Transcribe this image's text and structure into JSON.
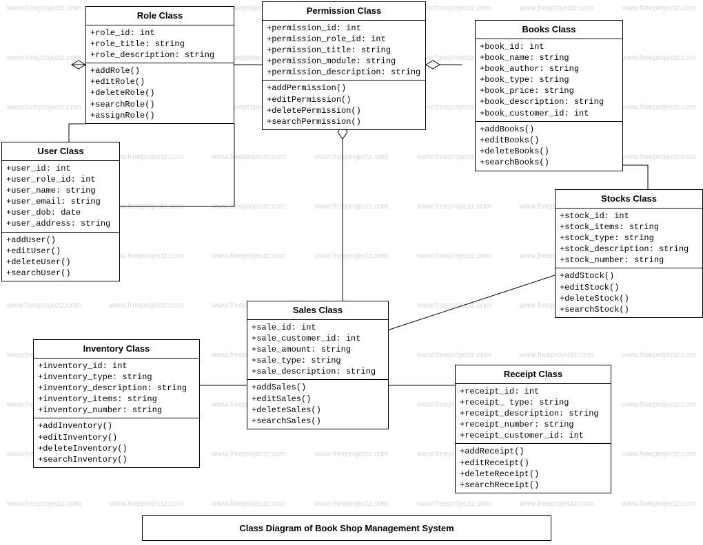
{
  "watermark_text": "www.freeprojectz.com",
  "diagram_title": "Class Diagram of Book Shop Management System",
  "classes": {
    "role": {
      "title": "Role Class",
      "attrs": [
        "+role_id: int",
        "+role_title: string",
        "+role_description: string"
      ],
      "ops": [
        "+addRole()",
        "+editRole()",
        "+deleteRole()",
        "+searchRole()",
        "+assignRole()"
      ]
    },
    "permission": {
      "title": "Permission Class",
      "attrs": [
        "+permission_id: int",
        "+permission_role_id: int",
        "+permission_title: string",
        "+permission_module: string",
        "+permission_description: string"
      ],
      "ops": [
        "+addPermission()",
        "+editPermission()",
        "+deletePermission()",
        "+searchPermission()"
      ]
    },
    "books": {
      "title": "Books Class",
      "attrs": [
        "+book_id: int",
        "+book_name: string",
        "+book_author: string",
        "+book_type: string",
        "+book_price: string",
        "+book_description: string",
        "+book_customer_id: int"
      ],
      "ops": [
        "+addBooks()",
        "+editBooks()",
        "+deleteBooks()",
        "+searchBooks()"
      ]
    },
    "user": {
      "title": "User Class",
      "attrs": [
        "+user_id: int",
        "+user_role_id: int",
        "+user_name: string",
        "+user_email: string",
        "+user_dob: date",
        "+user_address: string"
      ],
      "ops": [
        "+addUser()",
        "+editUser()",
        "+deleteUser()",
        "+searchUser()"
      ]
    },
    "sales": {
      "title": "Sales Class",
      "attrs": [
        "+sale_id: int",
        "+sale_customer_id: int",
        "+sale_amount: string",
        "+sale_type: string",
        "+sale_description: string"
      ],
      "ops": [
        "+addSales()",
        "+editSales()",
        "+deleteSales()",
        "+searchSales()"
      ]
    },
    "stocks": {
      "title": "Stocks Class",
      "attrs": [
        "+stock_id: int",
        "+stock_items: string",
        "+stock_type: string",
        "+stock_description: string",
        "+stock_number: string"
      ],
      "ops": [
        "+addStock()",
        "+editStock()",
        "+deleteStock()",
        "+searchStock()"
      ]
    },
    "inventory": {
      "title": "Inventory Class",
      "attrs": [
        "+inventory_id: int",
        "+inventory_type: string",
        "+inventory_description: string",
        "+inventory_items: string",
        "+inventory_number: string"
      ],
      "ops": [
        "+addInventory()",
        "+editInventory()",
        "+deleteInventory()",
        "+searchInventory()"
      ]
    },
    "receipt": {
      "title": "Receipt Class",
      "attrs": [
        "+receipt_id: int",
        "+receipt_ type: string",
        "+receipt_description: string",
        "+receipt_number: string",
        "+receipt_customer_id: int"
      ],
      "ops": [
        "+addReceipt()",
        "+editReceipt()",
        "+deleteReceipt()",
        "+searchReceipt()"
      ]
    }
  }
}
